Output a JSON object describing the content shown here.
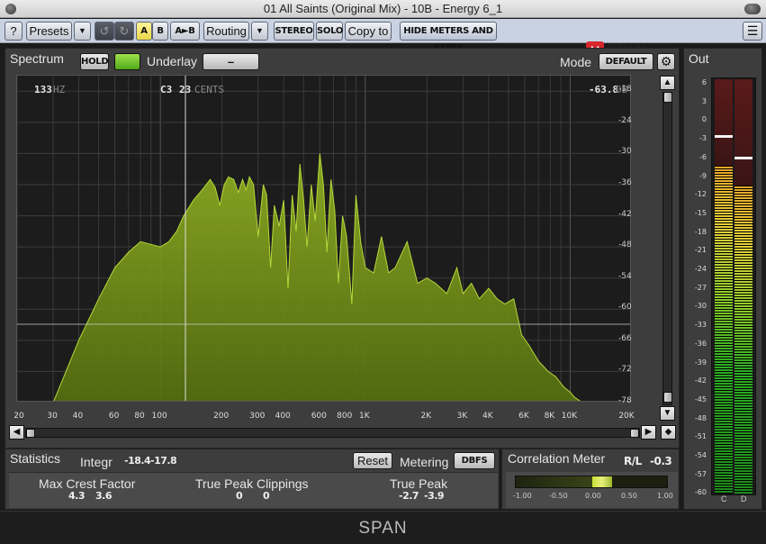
{
  "window": {
    "title": "01 All Saints (Original Mix) - 10B - Energy 6_1"
  },
  "toolbar": {
    "help": "?",
    "presets": "Presets",
    "dropdown": "▼",
    "undo": "↺",
    "redo": "↻",
    "a": "A",
    "b": "B",
    "atob": "A►B",
    "routing": "Routing",
    "routing_dropdown": "▼",
    "stereo": "STEREO",
    "solo": "SOLO",
    "copy_to": "Copy to",
    "hide_meters": "HIDE METERS AND STATS",
    "logo": "SPAN",
    "logo_mark": "V"
  },
  "spectrum": {
    "title": "Spectrum",
    "hold": "HOLD",
    "underlay_label": "Underlay",
    "underlay_value": "–",
    "mode_label": "Mode",
    "mode_value": "DEFAULT",
    "cursor_freq": "133",
    "cursor_freq_unit": "HZ",
    "cursor_note": "C3",
    "cursor_cents": "23",
    "cursor_cents_unit": "CENTS",
    "cursor_db": "-63.8",
    "cursor_db_unit": "DB",
    "db_scale": [
      "-18",
      "-24",
      "-30",
      "-36",
      "-42",
      "-48",
      "-54",
      "-60",
      "-66",
      "-72",
      "-78"
    ],
    "hz_scale": [
      "20",
      "30",
      "40",
      "60",
      "80",
      "100",
      "200",
      "300",
      "400",
      "600",
      "800",
      "1K",
      "2K",
      "3K",
      "4K",
      "6K",
      "8K",
      "10K",
      "20K"
    ],
    "fill_color": "#86a81c"
  },
  "statistics": {
    "title": "Statistics",
    "integr_label": "Integr",
    "integr_l": "-18.4",
    "integr_r": "-17.8",
    "reset": "Reset",
    "metering_label": "Metering",
    "metering_value": "DBFS",
    "crest_label": "Max Crest Factor",
    "crest_l": "4.3",
    "crest_r": "3.6",
    "clip_label": "True Peak Clippings",
    "clip_l": "0",
    "clip_r": "0",
    "tp_label": "True Peak",
    "tp_l": "-2.7",
    "tp_r": "-3.9"
  },
  "correlation": {
    "title": "Correlation Meter",
    "mode": "R/L",
    "value": "-0.3",
    "scale": [
      "-1.00",
      "-0.50",
      "0.00",
      "0.50",
      "1.00"
    ]
  },
  "out_meter": {
    "title": "Out",
    "scale": [
      "6",
      "3",
      "0",
      "-3",
      "-6",
      "-9",
      "-12",
      "-15",
      "-18",
      "-21",
      "-24",
      "-27",
      "-30",
      "-33",
      "-36",
      "-39",
      "-42",
      "-45",
      "-48",
      "-51",
      "-54",
      "-57",
      "-60"
    ],
    "channels": [
      "C",
      "D"
    ]
  },
  "footer": {
    "label": "SPAN"
  }
}
